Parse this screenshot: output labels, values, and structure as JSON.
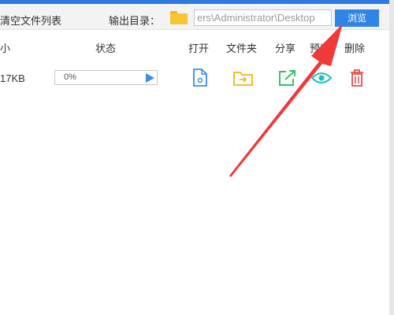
{
  "toolbar": {
    "clear_list_label": "清空文件列表",
    "output_dir_label": "输出目录：",
    "output_path": "ers\\Administrator\\Desktop",
    "browse_label": "浏览"
  },
  "table": {
    "headers": {
      "size": "小",
      "status": "状态",
      "open": "打开",
      "folder": "文件夹",
      "share": "分享",
      "preview": "预览",
      "delete": "删除"
    },
    "rows": [
      {
        "size": "17KB",
        "progress_text": "0%",
        "progress": 0
      }
    ]
  },
  "colors": {
    "accent": "#2e85e8",
    "open_icon": "#3a8ee6",
    "folder_icon": "#f0b51c",
    "share_icon": "#2fbf6b",
    "preview_icon": "#1fbfb8",
    "delete_icon": "#e84c4c",
    "annotation_arrow": "#f03a3a"
  }
}
